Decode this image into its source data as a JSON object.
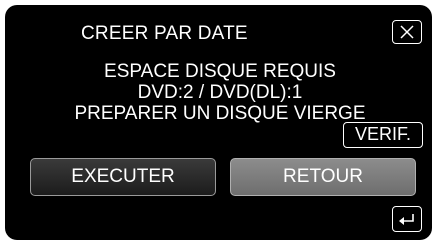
{
  "dialog": {
    "title": "CREER PAR DATE",
    "close_icon": "close-x-icon",
    "message_lines": [
      "ESPACE DISQUE REQUIS",
      "DVD:2 / DVD(DL):1",
      "PREPARER UN DISQUE VIERGE"
    ],
    "verify_label": "VERIF.",
    "execute_label": "EXECUTER",
    "back_label": "RETOUR",
    "return_icon": "return-arrow-icon"
  },
  "colors": {
    "background": "#000000",
    "text": "#ffffff",
    "execute_button": "#2a2a2a",
    "back_button": "#7d7d7d"
  }
}
